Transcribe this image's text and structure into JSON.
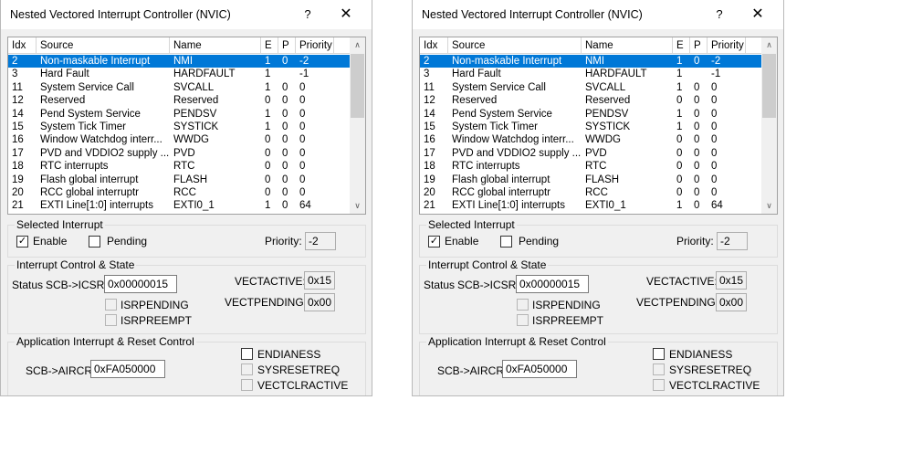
{
  "title": "Nested Vectored Interrupt Controller (NVIC)",
  "help_label": "?",
  "close_label": "✕",
  "columns": [
    "Idx",
    "Source",
    "Name",
    "E",
    "P",
    "Priority"
  ],
  "rows": [
    [
      "2",
      "Non-maskable Interrupt",
      "NMI",
      "1",
      "0",
      "-2"
    ],
    [
      "3",
      "Hard Fault",
      "HARDFAULT",
      "1",
      "",
      "-1"
    ],
    [
      "11",
      "System Service Call",
      "SVCALL",
      "1",
      "0",
      "0"
    ],
    [
      "12",
      "Reserved",
      "Reserved",
      "0",
      "0",
      "0"
    ],
    [
      "14",
      "Pend System Service",
      "PENDSV",
      "1",
      "0",
      "0"
    ],
    [
      "15",
      "System Tick Timer",
      "SYSTICK",
      "1",
      "0",
      "0"
    ],
    [
      "16",
      "Window Watchdog interr...",
      "WWDG",
      "0",
      "0",
      "0"
    ],
    [
      "17",
      "PVD and VDDIO2 supply ...",
      "PVD",
      "0",
      "0",
      "0"
    ],
    [
      "18",
      "RTC interrupts",
      "RTC",
      "0",
      "0",
      "0"
    ],
    [
      "19",
      "Flash global interrupt",
      "FLASH",
      "0",
      "0",
      "0"
    ],
    [
      "20",
      "RCC global interruptr",
      "RCC",
      "0",
      "0",
      "0"
    ],
    [
      "21",
      "EXTI Line[1:0] interrupts",
      "EXTI0_1",
      "1",
      "0",
      "64"
    ]
  ],
  "scroll_up": "∧",
  "scroll_down": "∨",
  "selected": {
    "group_label": "Selected Interrupt",
    "enable_label": "Enable",
    "enable_checked": true,
    "pending_label": "Pending",
    "pending_checked": false,
    "priority_label": "Priority:",
    "priority_value": "-2"
  },
  "icsr": {
    "group_label": "Interrupt Control & State",
    "status_label": "Status",
    "reg_label": "SCB->ICSR:",
    "reg_value": "0x00000015",
    "vectactive_label": "VECTACTIVE:",
    "vectactive_value": "0x15",
    "vectpending_label": "VECTPENDING:",
    "vectpending_value": "0x00",
    "isrpending_label": "ISRPENDING",
    "isrpreempt_label": "ISRPREEMPT"
  },
  "aircr": {
    "group_label": "Application Interrupt & Reset Control",
    "reg_label": "SCB->AIRCR:",
    "reg_value": "0xFA050000",
    "endianess_label": "ENDIANESS",
    "sysresetreq_label": "SYSRESETREQ",
    "vectclractive_label": "VECTCLRACTIVE"
  }
}
